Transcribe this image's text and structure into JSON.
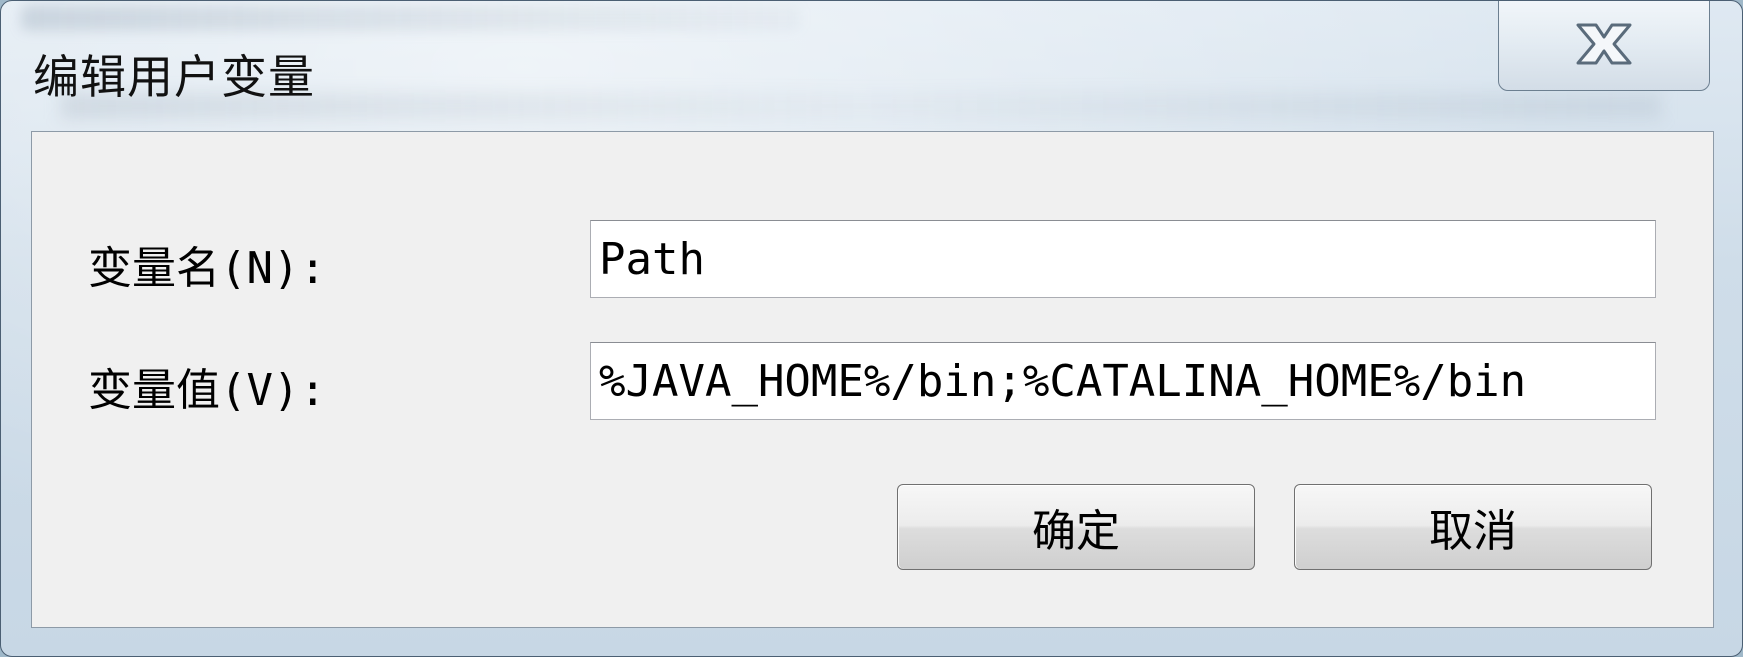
{
  "window": {
    "title": "编辑用户变量",
    "close_icon": "close-icon"
  },
  "form": {
    "name_label": "变量名(N):",
    "name_value": "Path",
    "value_label": "变量值(V):",
    "value_value": "%JAVA_HOME%/bin;%CATALINA_HOME%/bin"
  },
  "buttons": {
    "ok_label": "确定",
    "cancel_label": "取消"
  },
  "colors": {
    "client_bg": "#f0f0f0",
    "frame_border": "#4b5f73"
  }
}
